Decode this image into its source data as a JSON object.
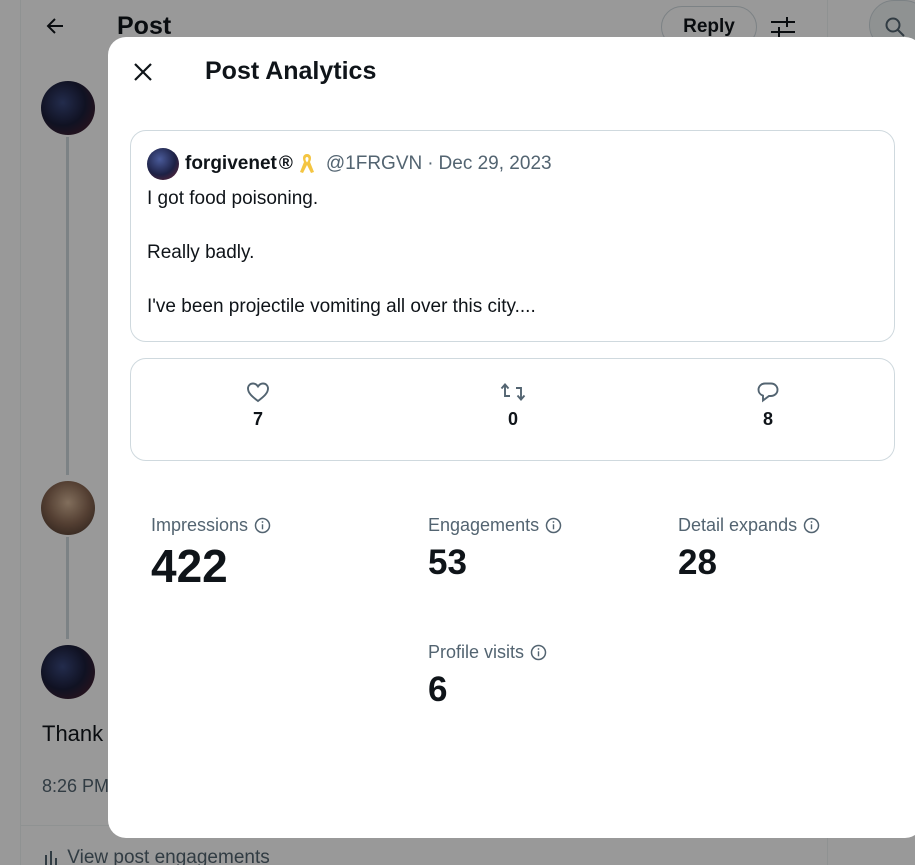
{
  "background": {
    "title": "Post",
    "reply_label": "Reply",
    "text_fragment": "Thank",
    "time_fragment": "8:26 PM",
    "engagements_link": "View post engagements"
  },
  "modal": {
    "title": "Post Analytics",
    "post": {
      "author_name": "forgivenet",
      "registered_mark": "®",
      "handle": "@1FRGVN",
      "separator": "·",
      "date": "Dec 29, 2023",
      "paragraphs": [
        "I got food poisoning.",
        "Really badly.",
        "I've been projectile vomiting all over this city...."
      ]
    },
    "stats": {
      "likes": "7",
      "reposts": "0",
      "replies": "8"
    },
    "metrics": {
      "impressions": {
        "label": "Impressions",
        "value": "422"
      },
      "engagements": {
        "label": "Engagements",
        "value": "53"
      },
      "detail_expands": {
        "label": "Detail expands",
        "value": "28"
      },
      "profile_visits": {
        "label": "Profile visits",
        "value": "6"
      }
    }
  },
  "colors": {
    "text_primary": "#0f1419",
    "text_secondary": "#536471",
    "border": "#cfd9de",
    "ribbon": "#f4c542"
  },
  "icons": [
    "back-arrow-icon",
    "tune-icon",
    "search-icon",
    "close-icon",
    "ribbon-icon",
    "heart-icon",
    "repost-icon",
    "reply-icon",
    "info-icon",
    "bar-chart-icon"
  ]
}
